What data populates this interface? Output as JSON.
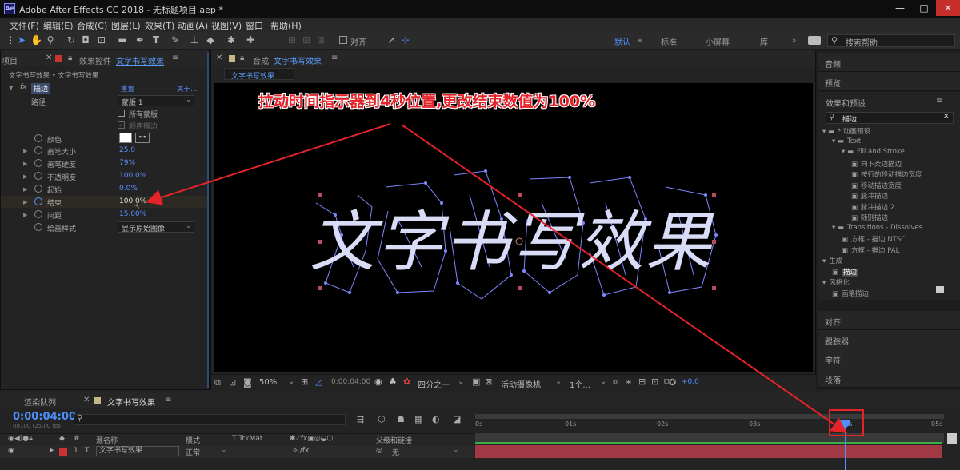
{
  "window": {
    "title": "Adobe After Effects CC 2018 - 无标题项目.aep *",
    "app_icon": "Ae",
    "min": "—",
    "max": "□",
    "close": "✕"
  },
  "menu": [
    "文件(F)",
    "编辑(E)",
    "合成(C)",
    "图层(L)",
    "效果(T)",
    "动画(A)",
    "视图(V)",
    "窗口",
    "帮助(H)"
  ],
  "toolbar": {
    "snap_label": "对齐",
    "workspaces": [
      "默认",
      "标准",
      "小屏幕",
      "库"
    ],
    "search_placeholder": "搜索帮助"
  },
  "effects_panel": {
    "tab_project": "项目",
    "tab_label": "效果控件",
    "tab_comp": "文字书写效果",
    "breadcrumb": "文字书写效果 • 文字书写效果",
    "effect": {
      "name": "描边",
      "reset": "重置",
      "about": "关于..."
    },
    "path_label": "路径",
    "path_value": "蒙版 1",
    "all_masks": "所有蒙版",
    "sequential": "顺序描边",
    "props": [
      {
        "label": "颜色",
        "value": ""
      },
      {
        "label": "画笔大小",
        "value": "25.0"
      },
      {
        "label": "画笔硬度",
        "value": "79%"
      },
      {
        "label": "不透明度",
        "value": "100.0%"
      },
      {
        "label": "起始",
        "value": "0.0%"
      },
      {
        "label": "结束",
        "value": "100.0%"
      },
      {
        "label": "间距",
        "value": "15.00%"
      },
      {
        "label": "绘画样式",
        "value": "显示原始图像"
      }
    ]
  },
  "composition": {
    "tab_label": "合成",
    "tab_comp": "文字书写效果",
    "subtab": "文字书写效果",
    "annotation": "拉动时间指示器到4秒位置,更改结束数值为100%",
    "text": [
      "文",
      "字",
      "书",
      "写",
      "效",
      "果"
    ]
  },
  "viewer_bar": {
    "zoom": "50%",
    "time": "0:00:04:00",
    "resolution": "四分之一",
    "camera": "活动摄像机",
    "views": "1个...",
    "exposure": "+0.0"
  },
  "right_panel": {
    "items_top": [
      "音频",
      "预览"
    ],
    "effects_title": "效果和预设",
    "search_value": "描边",
    "tree": [
      {
        "label": "* 动画预设",
        "indent": 0,
        "type": "folder"
      },
      {
        "label": "Text",
        "indent": 1,
        "type": "folder"
      },
      {
        "label": "Fill and Stroke",
        "indent": 2,
        "type": "folder"
      },
      {
        "label": "向下柔边描边",
        "indent": 3,
        "type": "preset"
      },
      {
        "label": "按行的移动描边宽度",
        "indent": 3,
        "type": "preset"
      },
      {
        "label": "移动描边宽度",
        "indent": 3,
        "type": "preset"
      },
      {
        "label": "脉冲描边",
        "indent": 3,
        "type": "preset"
      },
      {
        "label": "脉冲描边 2",
        "indent": 3,
        "type": "preset"
      },
      {
        "label": "随则描边",
        "indent": 3,
        "type": "preset"
      },
      {
        "label": "Transitions - Dissolves",
        "indent": 1,
        "type": "folder"
      },
      {
        "label": "方框 - 描边 NTSC",
        "indent": 2,
        "type": "preset"
      },
      {
        "label": "方框 - 描边 PAL",
        "indent": 2,
        "type": "preset"
      },
      {
        "label": "生成",
        "indent": 0,
        "type": "category"
      },
      {
        "label": "描边",
        "indent": 1,
        "type": "effect"
      },
      {
        "label": "风格化",
        "indent": 0,
        "type": "category"
      },
      {
        "label": "画笔描边",
        "indent": 1,
        "type": "effect"
      }
    ],
    "items_bottom": [
      "对齐",
      "跟踪器",
      "字符",
      "段落"
    ]
  },
  "timeline": {
    "tab_render": "渲染队列",
    "tab_comp": "文字书写效果",
    "timecode": "0:00:04:00",
    "fps": "00100 (25.00 fps)",
    "ruler": [
      "0s",
      "01s",
      "02s",
      "03s",
      "04s",
      "05s"
    ],
    "headers": {
      "num": "#",
      "source": "源名称",
      "mode": "模式",
      "trkmat": "T  TrkMat",
      "parent": "父级和链接"
    },
    "layer": {
      "num": "1",
      "type": "T",
      "name": "文字书写效果",
      "mode": "正常",
      "parent": "无"
    }
  },
  "colors": {
    "accent": "#4e8fff",
    "annotation": "#e5232a",
    "layer_bar": "#a23a46",
    "mask": "#7e87ff"
  }
}
